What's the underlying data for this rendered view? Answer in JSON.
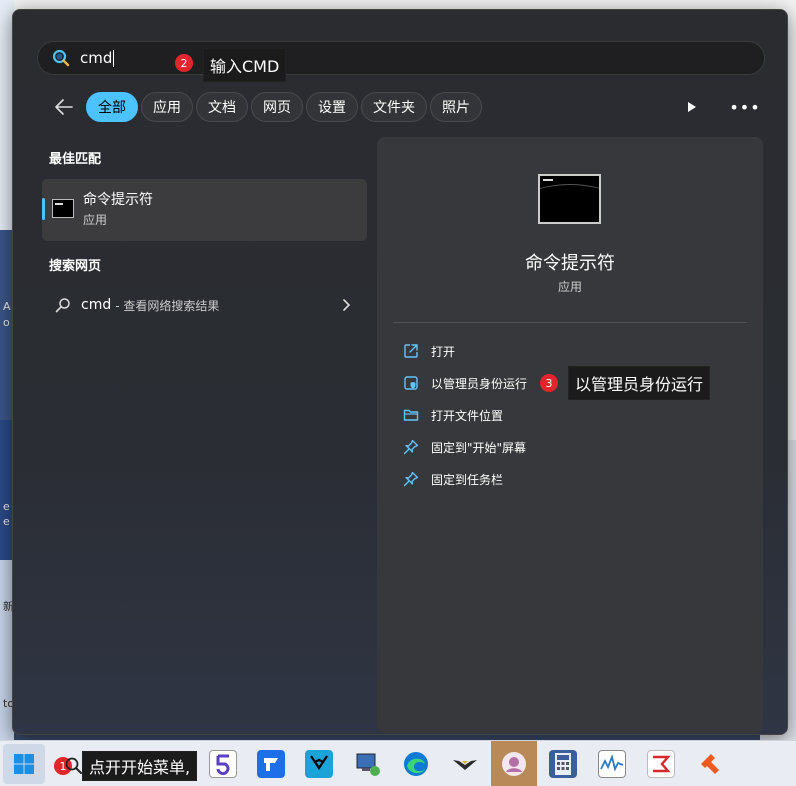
{
  "search": {
    "query": "cmd"
  },
  "annotations": {
    "step1": {
      "number": "1",
      "text": "点开开始菜单,"
    },
    "step2": {
      "number": "2",
      "text": "输入CMD"
    },
    "step3": {
      "number": "3",
      "text": "以管理员身份运行"
    }
  },
  "filters": [
    "全部",
    "应用",
    "文档",
    "网页",
    "设置",
    "文件夹",
    "照片"
  ],
  "active_filter": "全部",
  "more_label": "•••",
  "best_match": {
    "section_title": "最佳匹配",
    "title": "命令提示符",
    "subtitle": "应用"
  },
  "web_search": {
    "section_title": "搜索网页",
    "query": "cmd",
    "suffix": "- 查看网络搜索结果"
  },
  "detail": {
    "title": "命令提示符",
    "subtitle": "应用",
    "actions": [
      {
        "label": "打开",
        "icon": "open-external-icon"
      },
      {
        "label": "以管理员身份运行",
        "icon": "shield-icon"
      },
      {
        "label": "打开文件位置",
        "icon": "folder-icon"
      },
      {
        "label": "固定到\"开始\"屏幕",
        "icon": "pin-icon"
      },
      {
        "label": "固定到任务栏",
        "icon": "pin-icon"
      }
    ]
  },
  "background_text": [
    "A",
    "o",
    "e",
    "e",
    "新",
    "to"
  ],
  "colors": {
    "accent": "#4cc2ff",
    "badge": "#e0262b",
    "menu_bg": "#2b2c30",
    "pane_bg": "#37383b"
  }
}
